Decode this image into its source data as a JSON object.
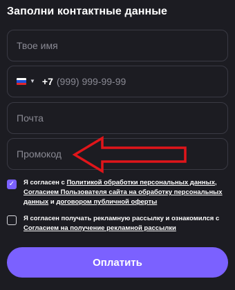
{
  "form": {
    "title": "Заполни контактные данные",
    "name_placeholder": "Твое имя",
    "phone": {
      "country_icon": "russia-flag-icon",
      "code": "+7",
      "placeholder": "(999) 999-99-99"
    },
    "email_placeholder": "Почта",
    "promo_placeholder": "Промокод"
  },
  "annotation": {
    "arrow_color": "#e0151a"
  },
  "consents": [
    {
      "checked": true,
      "text_1": "Я согласен с ",
      "link_1": "Политикой обработки персональных данных",
      "text_2": ", ",
      "link_2": "Согласием Пользователя сайта на обработку персональных данных",
      "text_3": " и ",
      "link_3": "договором публичной оферты"
    },
    {
      "checked": false,
      "text_1": "Я согласен получать рекламную рассылку и ознакомился с ",
      "link_1": "Согласием на получение рекламной рассылки"
    }
  ],
  "submit": {
    "label": "Оплатить"
  },
  "colors": {
    "accent": "#7b61ff",
    "background": "#1c1c22",
    "field_border": "#3a3a44",
    "placeholder": "#8a8a94"
  }
}
